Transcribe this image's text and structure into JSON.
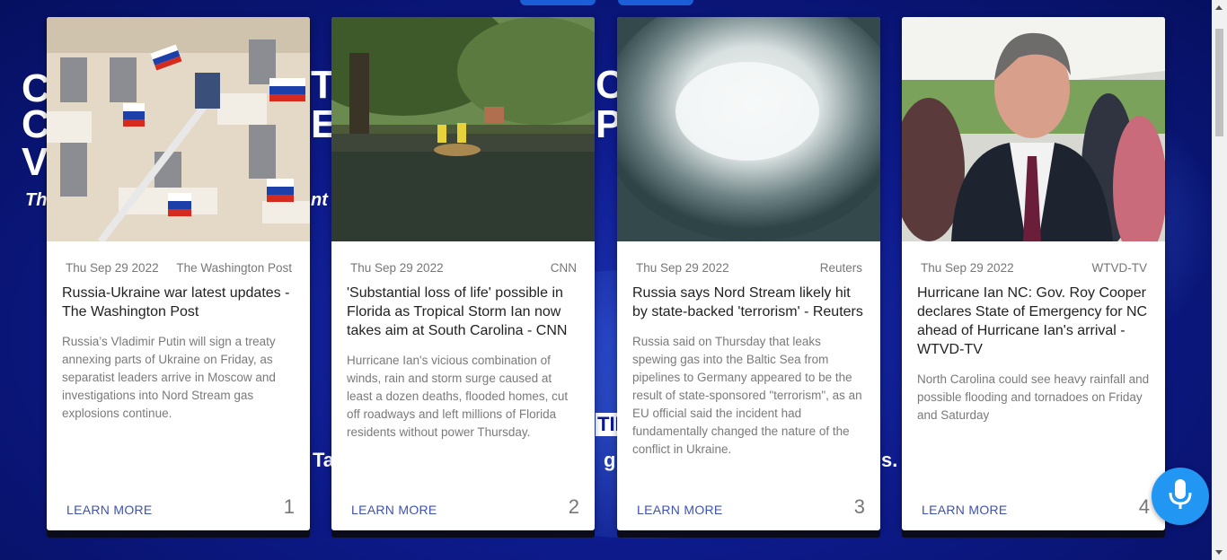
{
  "background": {
    "lines_left": [
      "C",
      "C",
      "V"
    ],
    "fragment_ti": "TI",
    "fragment_ed": "ED",
    "fragment_ce": "CE",
    "fragment_p": "P",
    "tagline_left": "Th",
    "tagline_nt": "nt",
    "mid_tip": "TIP",
    "bottom_ta": "Ta",
    "bottom_g": "g",
    "bottom_s": "s."
  },
  "cards": [
    {
      "date": "Thu Sep 29 2022",
      "source": "The Washington Post",
      "title": "Russia-Ukraine war latest updates - The Washington Post",
      "description": "Russia’s Vladimir Putin will sign a treaty annexing parts of Ukraine on Friday, as separatist leaders arrive in Moscow and investigations into Nord Stream gas explosions continue.",
      "action": "LEARN MORE",
      "number": "1"
    },
    {
      "date": "Thu Sep 29 2022",
      "source": "CNN",
      "title": "'Substantial loss of life' possible in Florida as Tropical Storm Ian now takes aim at South Carolina - CNN",
      "description": "Hurricane Ian's vicious combination of winds, rain and storm surge caused at least a dozen deaths, flooded homes, cut off roadways and left millions of Florida residents without power Thursday.",
      "action": "LEARN MORE",
      "number": "2"
    },
    {
      "date": "Thu Sep 29 2022",
      "source": "Reuters",
      "title": "Russia says Nord Stream likely hit by state-backed 'terrorism' - Reuters",
      "description": "Russia said on Thursday that leaks spewing gas into the Baltic Sea from pipelines to Germany appeared to be the result of state-sponsored \"terrorism\", as an EU official said the incident had fundamentally changed the nature of the conflict in Ukraine.",
      "action": "LEARN MORE",
      "number": "3"
    },
    {
      "date": "Thu Sep 29 2022",
      "source": "WTVD-TV",
      "title": "Hurricane Ian NC: Gov. Roy Cooper declares State of Emergency for NC ahead of Hurricane Ian's arrival - WTVD-TV",
      "description": "North Carolina could see heavy rainfall and possible flooding and tornadoes on Friday and Saturday",
      "action": "LEARN MORE",
      "number": "4"
    }
  ],
  "icons": {
    "mic": "microphone-icon"
  },
  "colors": {
    "accent": "#2196f3",
    "link": "#3f51b5",
    "background": "#0d1a8a"
  }
}
